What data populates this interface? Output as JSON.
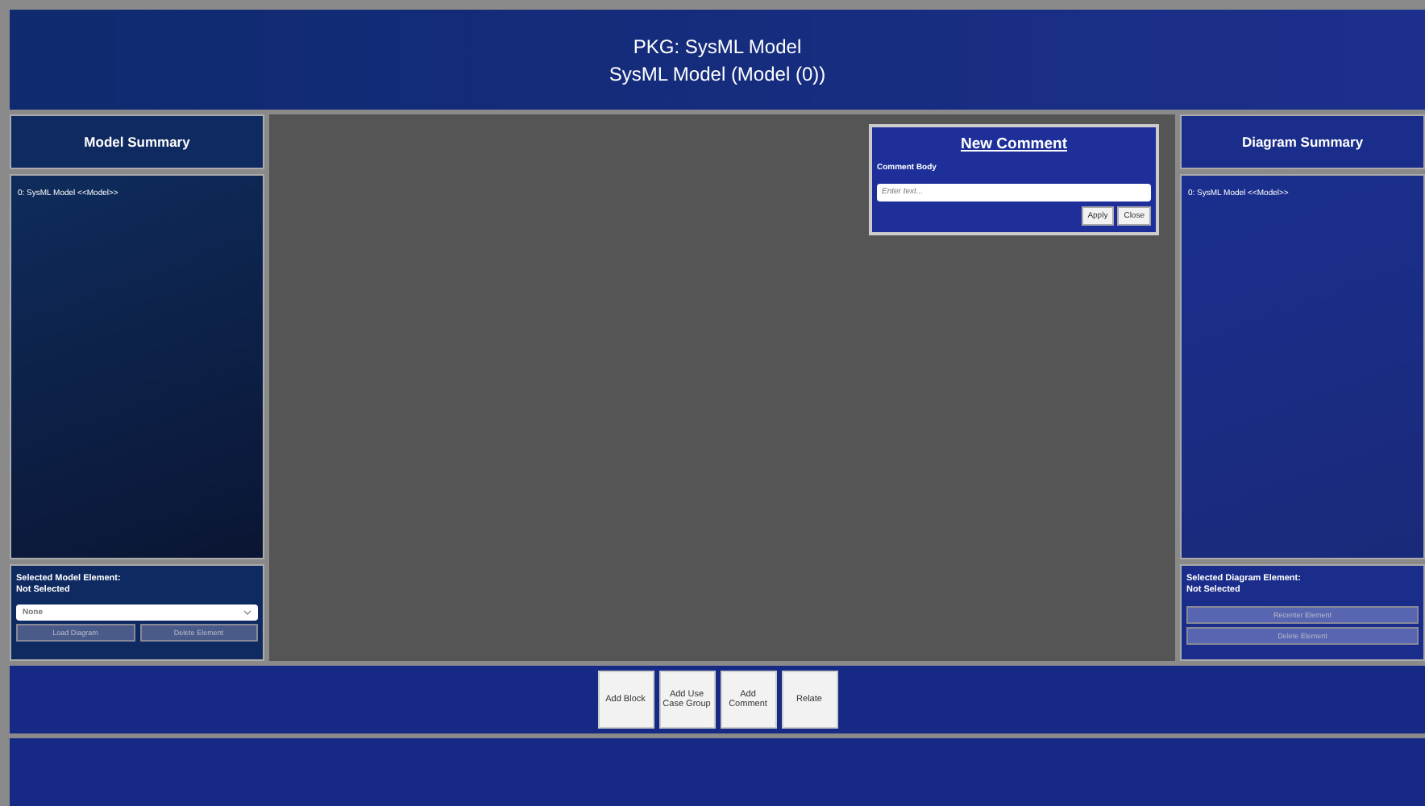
{
  "header": {
    "title": "PKG: SysML Model",
    "subtitle": "SysML Model (Model (0))"
  },
  "model_summary": {
    "title": "Model Summary",
    "items": [
      "0: SysML Model <<Model>>"
    ]
  },
  "selected_model_element": {
    "label": "Selected Model Element:",
    "status": "Not Selected",
    "select_value": "None",
    "buttons": [
      {
        "label": "Load Diagram",
        "disabled": true
      },
      {
        "label": "Delete Element",
        "disabled": true
      }
    ]
  },
  "new_comment": {
    "title": "New Comment",
    "field_label": "Comment Body",
    "placeholder": "Enter text...",
    "buttons": [
      {
        "label": "Apply"
      },
      {
        "label": "Close"
      }
    ]
  },
  "diagram_summary": {
    "title": "Diagram Summary",
    "items": [
      "0: SysML Model <<Model>>"
    ]
  },
  "selected_diagram_element": {
    "label": "Selected Diagram Element:",
    "status": "Not Selected",
    "buttons": [
      {
        "label": "Recenter Element",
        "disabled": true
      },
      {
        "label": "Delete Element",
        "disabled": true
      }
    ]
  },
  "toolbar": {
    "buttons": [
      {
        "label": "Add Block"
      },
      {
        "label": "Add Use Case Group"
      },
      {
        "label": "Add Comment"
      },
      {
        "label": "Relate"
      }
    ]
  }
}
